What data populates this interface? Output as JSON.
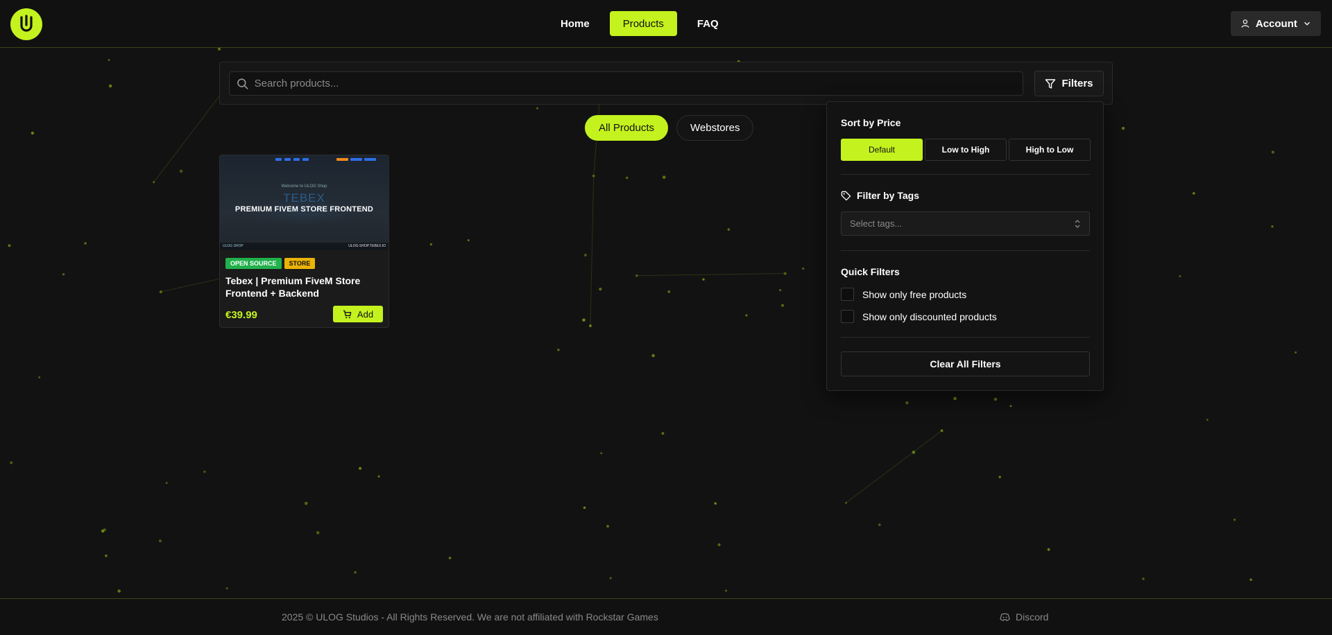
{
  "brand": {
    "accent": "#c4f21e",
    "logo_letter": "U"
  },
  "nav": {
    "items": [
      {
        "label": "Home",
        "active": false
      },
      {
        "label": "Products",
        "active": true
      },
      {
        "label": "FAQ",
        "active": false
      }
    ],
    "account_label": "Account"
  },
  "search": {
    "placeholder": "Search products...",
    "value": "",
    "filters_label": "Filters"
  },
  "categories": [
    {
      "label": "All Products",
      "active": true
    },
    {
      "label": "Webstores",
      "active": false
    }
  ],
  "products": [
    {
      "thumb_welcome": "Welcome to ULOG Shop",
      "thumb_watermark": "TEBEX",
      "thumb_title": "PREMIUM FIVEM STORE FRONTEND",
      "thumb_foot_left": "ULOG SHOP",
      "thumb_foot_right": "ULOG-SHOP.TEBEX.IO",
      "badges": [
        "OPEN SOURCE",
        "STORE"
      ],
      "title": "Tebex | Premium FiveM Store Frontend + Backend",
      "price": "€39.99",
      "add_label": "Add"
    }
  ],
  "filter_panel": {
    "sort_title": "Sort by Price",
    "sort_options": [
      {
        "label": "Default",
        "active": true
      },
      {
        "label": "Low to High",
        "active": false
      },
      {
        "label": "High to Low",
        "active": false
      }
    ],
    "tags_title": "Filter by Tags",
    "tags_placeholder": "Select tags...",
    "quick_title": "Quick Filters",
    "quick_options": [
      {
        "label": "Show only free products",
        "checked": false
      },
      {
        "label": "Show only discounted products",
        "checked": false
      }
    ],
    "clear_label": "Clear All Filters"
  },
  "footer": {
    "copyright": "2025 © ULOG Studios - All Rights Reserved. We are not affiliated with Rockstar Games",
    "discord_label": "Discord"
  }
}
